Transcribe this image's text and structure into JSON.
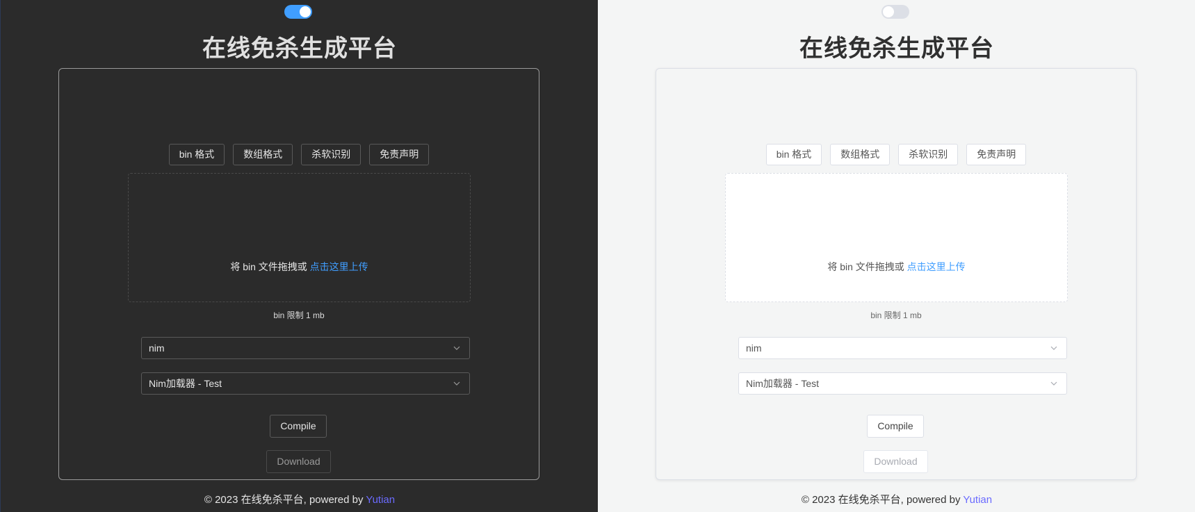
{
  "colors": {
    "dark_bg": "#2b2b2b",
    "light_bg": "#f4f5f5",
    "accent": "#409eff",
    "author_link": "#6b6bff"
  },
  "theme_toggle": {
    "dark_panel_state": "on",
    "light_panel_state": "off"
  },
  "title": "在线免杀生成平台",
  "tabs": [
    "bin 格式",
    "数组格式",
    "杀软识别",
    "免责声明"
  ],
  "upload": {
    "prefix": "将 bin 文件拖拽或 ",
    "link": "点击这里上传",
    "limit": "bin 限制 1 mb"
  },
  "selects": {
    "language": "nim",
    "loader": "Nim加载器 - Test",
    "chevron_icon": "chevron-down-icon"
  },
  "buttons": {
    "compile": "Compile",
    "download": "Download"
  },
  "footer": {
    "prefix": "© 2023 在线免杀平台, powered by ",
    "author": "Yutian"
  }
}
